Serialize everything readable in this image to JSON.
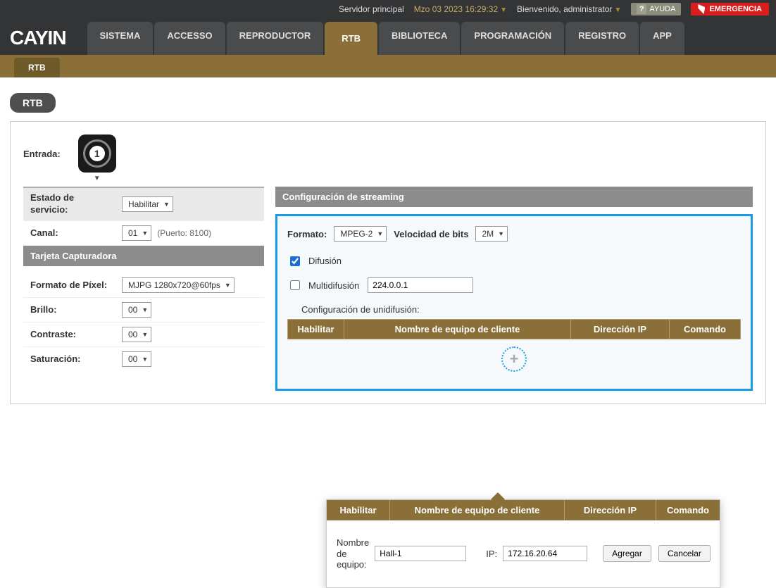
{
  "topbar": {
    "server": "Servidor principal",
    "date": "Mzo 03 2023 16:29:32",
    "welcome": "Bienvenido, administrator",
    "help": "AYUDA",
    "emergency": "EMERGENCIA"
  },
  "logo": "CAYIN",
  "nav": {
    "tabs": [
      "SISTEMA",
      "ACCESSO",
      "REPRODUCTOR",
      "RTB",
      "BIBLIOTECA",
      "PROGRAMACIÓN",
      "REGISTRO",
      "APP"
    ],
    "active": "RTB"
  },
  "subnav": {
    "tab": "RTB"
  },
  "page": {
    "title": "RTB"
  },
  "entrada": {
    "label": "Entrada:",
    "num": "1"
  },
  "left": {
    "svc_label1": "Estado de",
    "svc_label2": "servicio:",
    "svc_value": "Habilitar",
    "ch_label": "Canal:",
    "ch_value": "01",
    "port_note": "(Puerto: 8100)",
    "cap_head": "Tarjeta Capturadora",
    "px_label": "Formato de Píxel:",
    "px_value": "MJPG 1280x720@60fps",
    "bright_label": "Brillo:",
    "bright_value": "00",
    "contrast_label": "Contraste:",
    "contrast_value": "00",
    "sat_label": "Saturación:",
    "sat_value": "00"
  },
  "stream": {
    "head": "Configuración de streaming",
    "fmt_label": "Formato:",
    "fmt_value": "MPEG-2",
    "br_label": "Velocidad de bits",
    "br_value": "2M",
    "broadcast_label": "Difusión",
    "multicast_label": "Multidifusión",
    "multicast_ip": "224.0.0.1",
    "uni_label": "Configuración de unidifusión:",
    "col_enable": "Habilitar",
    "col_name": "Nombre de equipo de cliente",
    "col_ip": "Dirección IP",
    "col_cmd": "Comando"
  },
  "popup": {
    "col_enable": "Habilitar",
    "col_name": "Nombre de equipo de cliente",
    "col_ip": "Dirección IP",
    "col_cmd": "Comando",
    "name_label1": "Nombre",
    "name_label2": "de equipo:",
    "name_value": "Hall-1",
    "ip_label": "IP:",
    "ip_value": "172.16.20.64",
    "add": "Agregar",
    "cancel": "Cancelar"
  }
}
